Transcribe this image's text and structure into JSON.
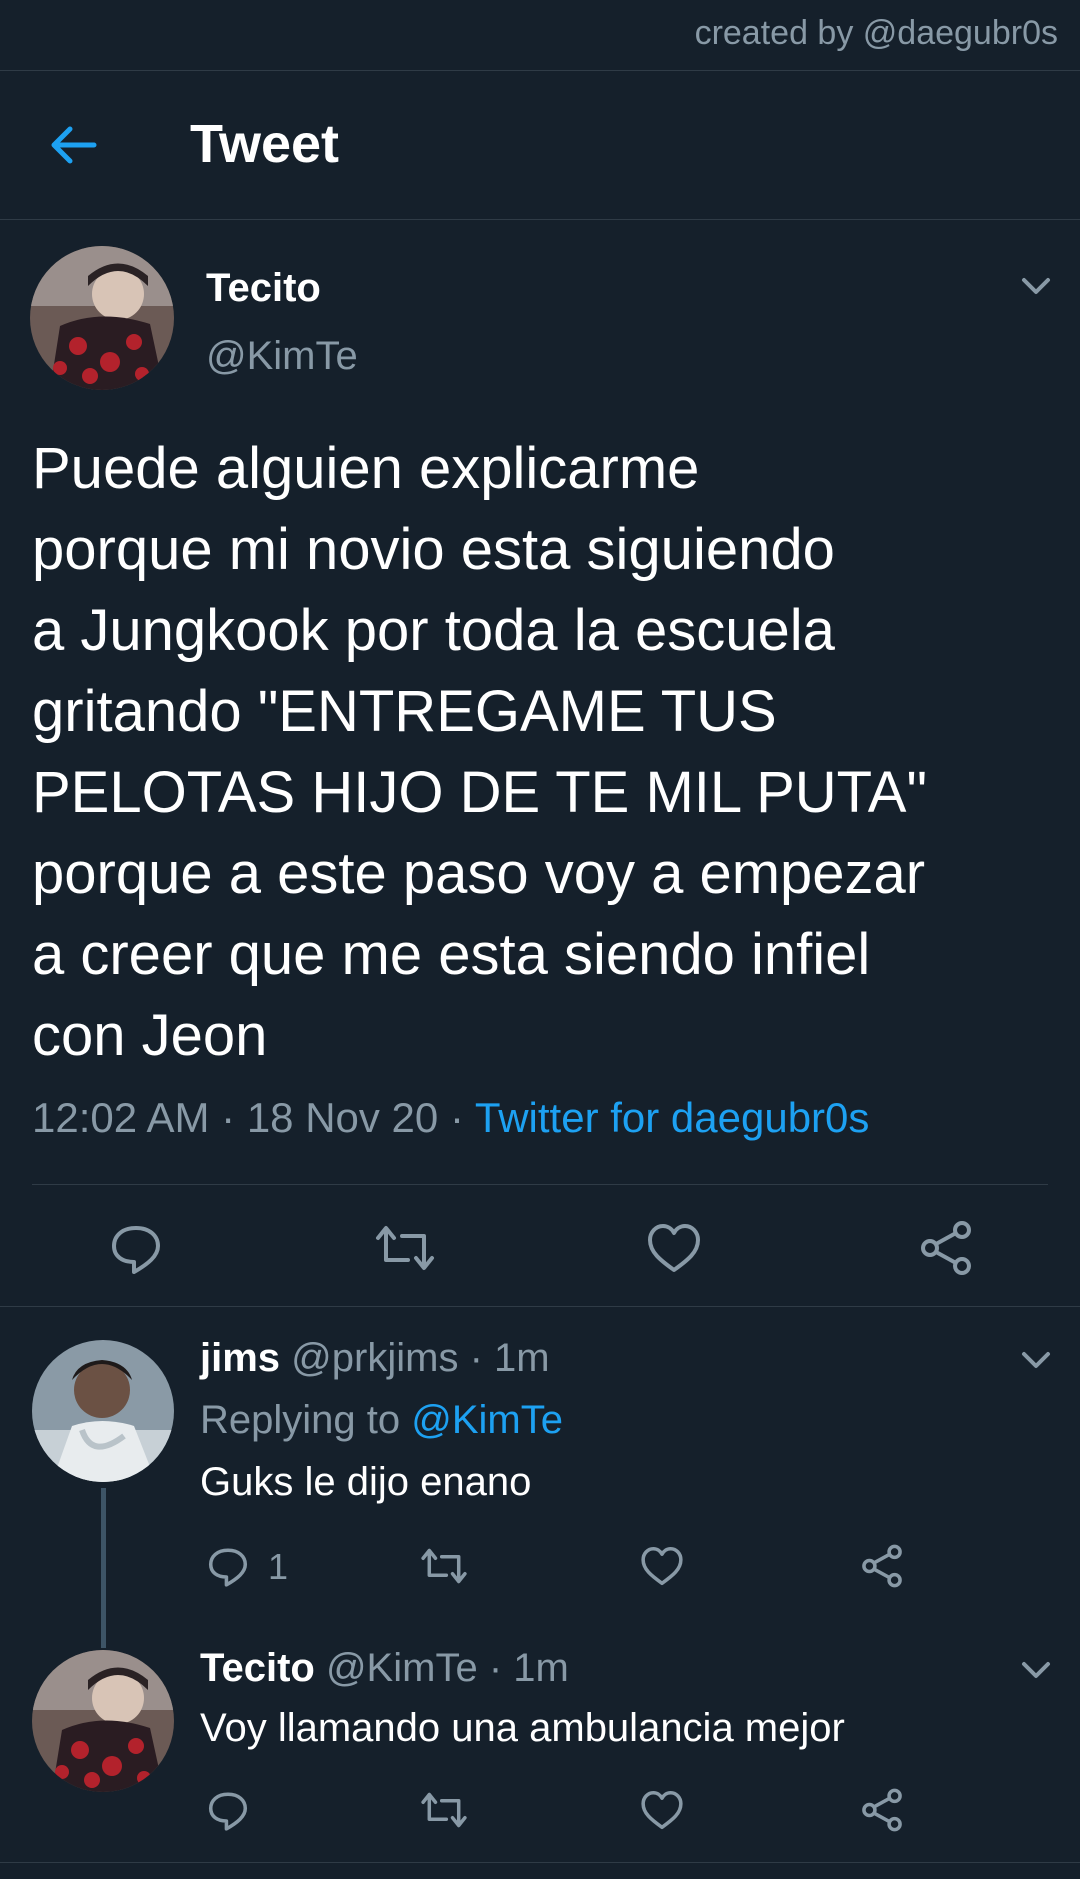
{
  "watermark": "created by @daegubr0s",
  "header": {
    "title": "Tweet"
  },
  "tweet": {
    "name": "Tecito",
    "handle": "@KimTe",
    "lines": [
      "Puede alguien explicarme",
      "porque mi novio esta siguiendo",
      "a Jungkook por toda la escuela",
      "gritando \"ENTREGAME TUS",
      "PELOTAS HIJO DE TE MIL PUTA\"",
      "porque a este paso voy a empezar",
      "a creer que me esta siendo infiel",
      "con Jeon"
    ],
    "time": "12:02 AM",
    "date": "18 Nov 20",
    "sep": "·",
    "source": "Twitter for daegubr0s"
  },
  "replies": [
    {
      "name": "jims",
      "handle": "@prkjims",
      "age": "1m",
      "replying_label": "Replying to",
      "replying_handle": "@KimTe",
      "text": "Guks le dijo enano",
      "reply_count": "1"
    },
    {
      "name": "Tecito",
      "handle": "@KimTe",
      "age": "1m",
      "text": "Voy llamando una ambulancia mejor"
    }
  ],
  "colors": {
    "background": "#15202b",
    "accent": "#1da1f2",
    "muted": "#8899a6",
    "divider": "#2f3b46"
  },
  "icons": [
    "back-arrow-icon",
    "chevron-down-icon",
    "reply-icon",
    "retweet-icon",
    "like-icon",
    "share-icon"
  ]
}
